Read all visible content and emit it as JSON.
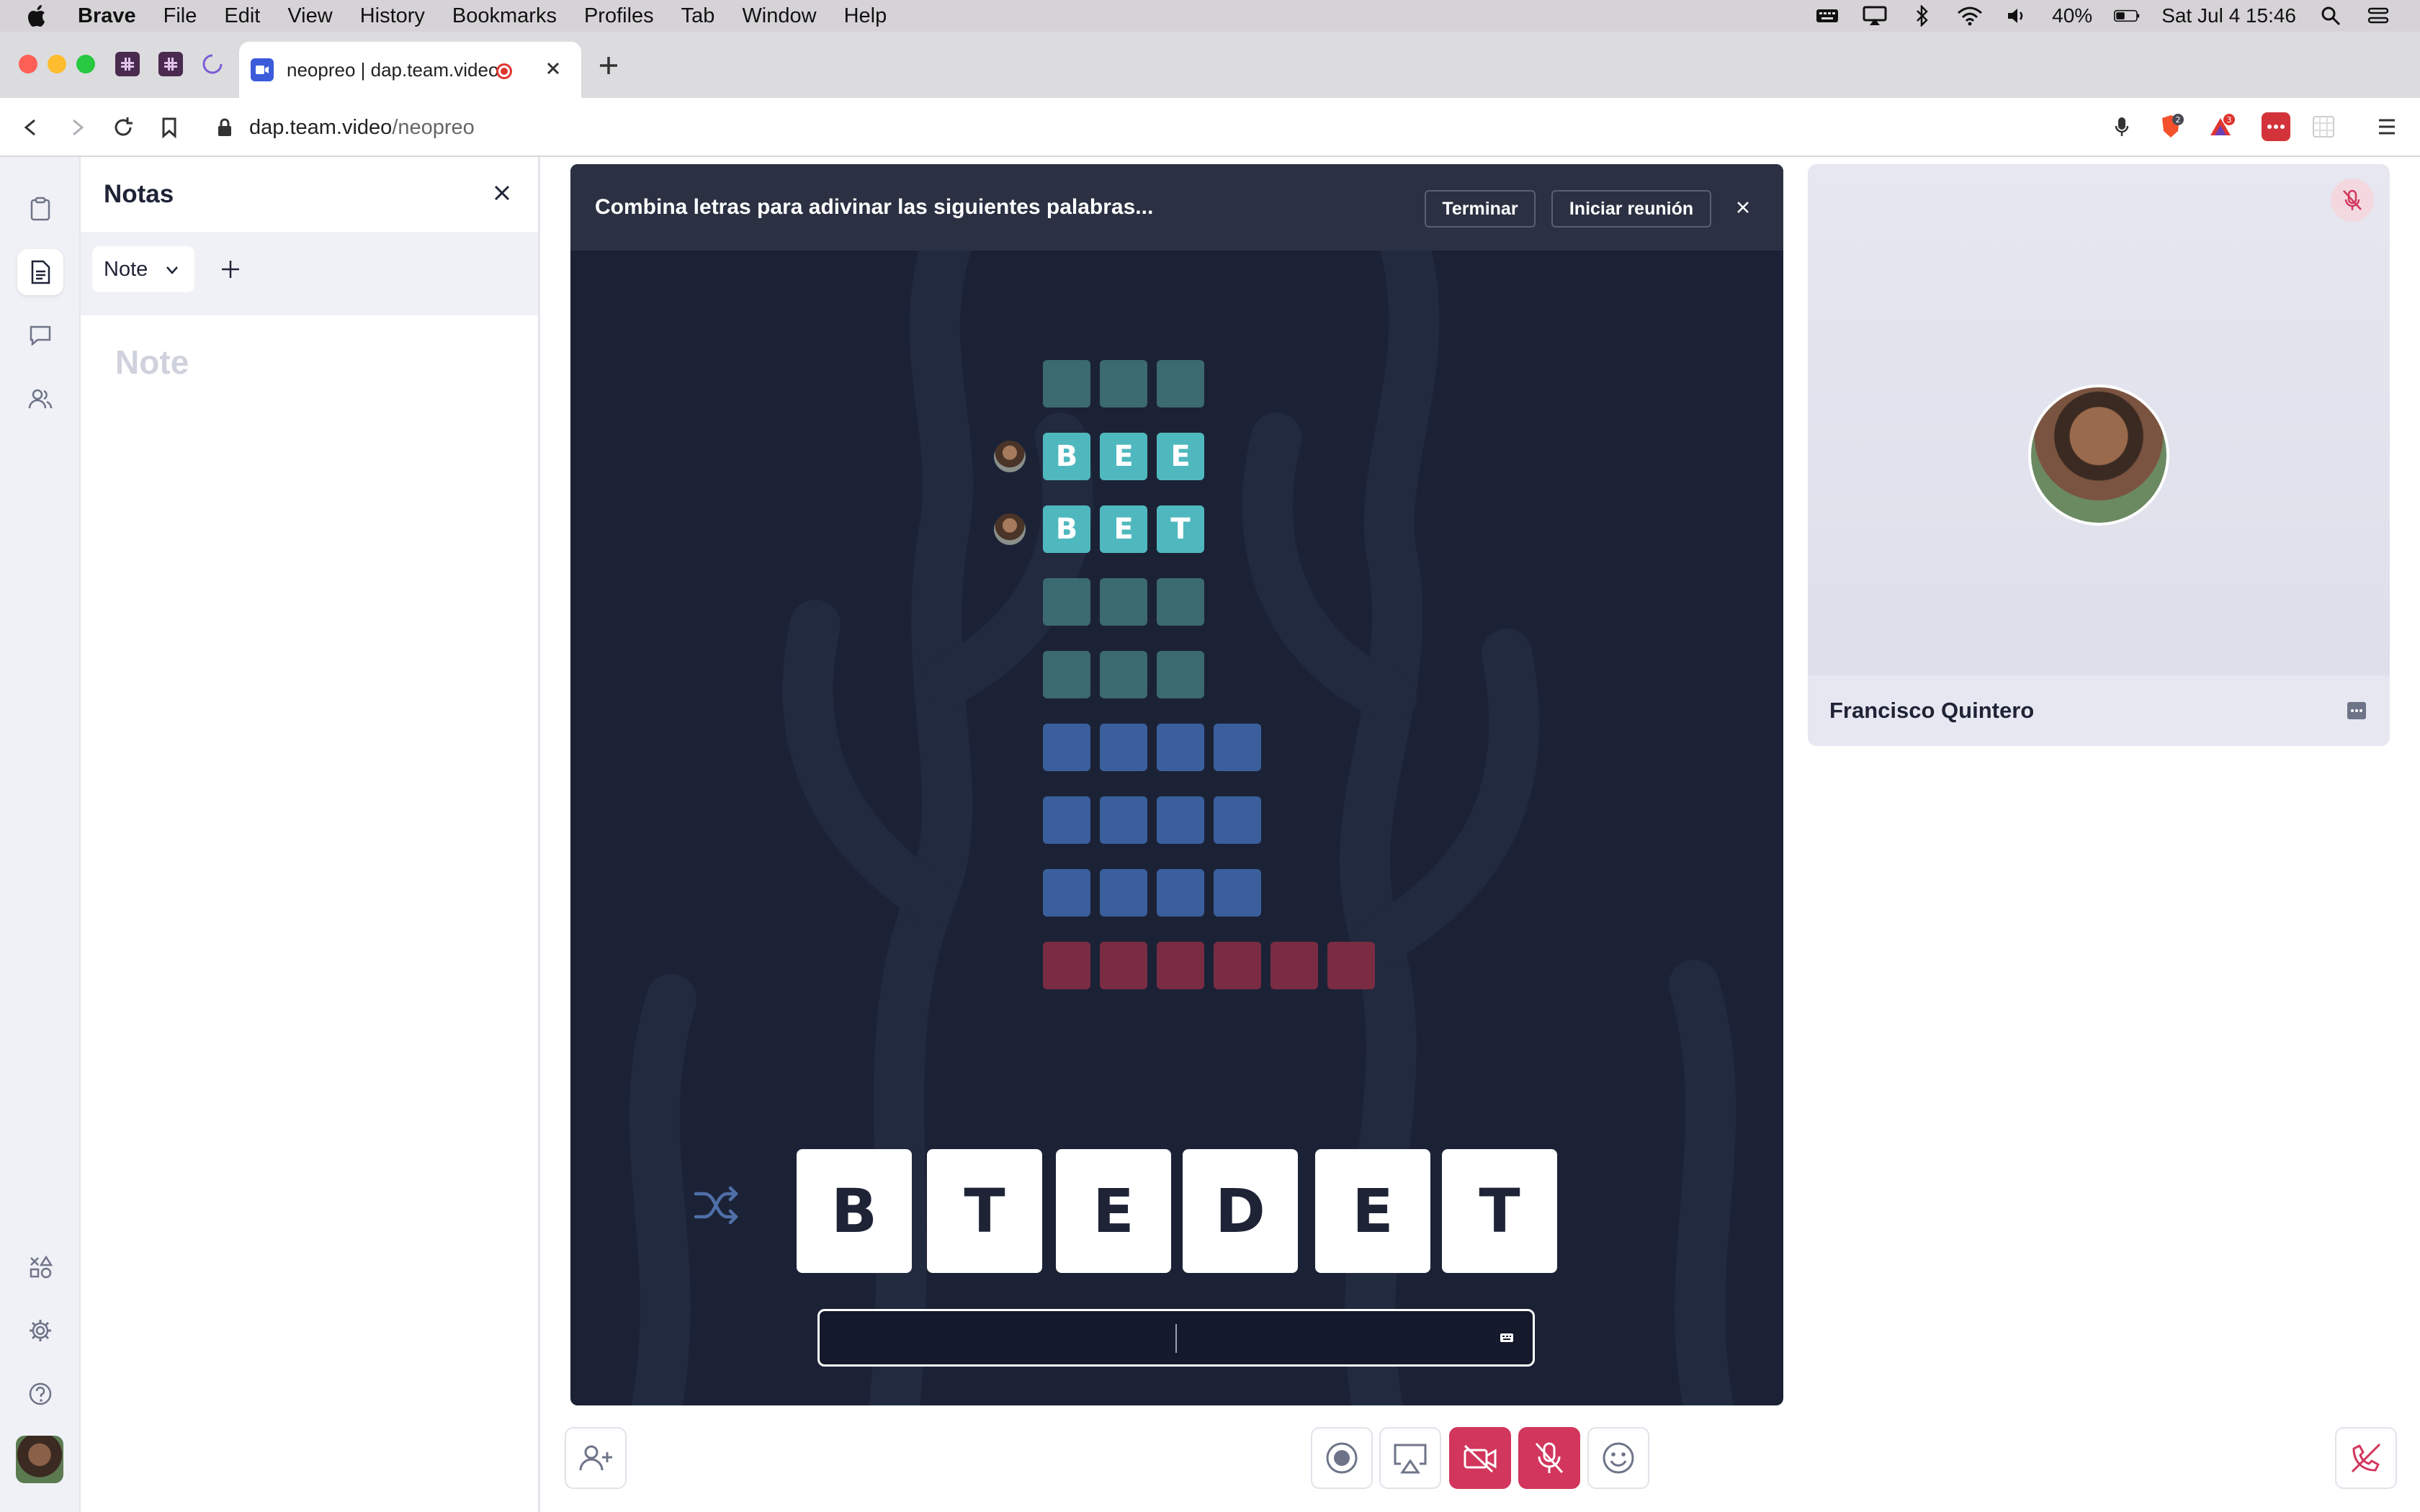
{
  "menubar": {
    "app": "Brave",
    "items": [
      "File",
      "Edit",
      "View",
      "History",
      "Bookmarks",
      "Profiles",
      "Tab",
      "Window",
      "Help"
    ],
    "battery": "40%",
    "clock": "Sat Jul 4  15:46"
  },
  "browser": {
    "tab_title": "neopreo | dap.team.video",
    "url_host": "dap.team.video",
    "url_path": "/neopreo",
    "brave_badge": "2",
    "alert_badge": "3"
  },
  "notes": {
    "title": "Notas",
    "selected_note": "Note",
    "placeholder": "Note"
  },
  "game": {
    "prompt": "Combina letras para adivinar las siguientes palabras...",
    "end_label": "Terminar",
    "start_meeting_label": "Iniciar reunión",
    "rows": [
      {
        "length": 3,
        "letters": [
          "",
          "",
          ""
        ],
        "state": "empty",
        "color": "#3b6a70"
      },
      {
        "length": 3,
        "letters": [
          "B",
          "E",
          "E"
        ],
        "state": "found",
        "color": "#4fb8be",
        "found_by_avatar": true
      },
      {
        "length": 3,
        "letters": [
          "B",
          "E",
          "T"
        ],
        "state": "found",
        "color": "#4fb8be",
        "found_by_avatar": true
      },
      {
        "length": 3,
        "letters": [
          "",
          "",
          ""
        ],
        "state": "empty",
        "color": "#3b6a70"
      },
      {
        "length": 3,
        "letters": [
          "",
          "",
          ""
        ],
        "state": "empty",
        "color": "#3b6a70"
      },
      {
        "length": 4,
        "letters": [
          "",
          "",
          "",
          ""
        ],
        "state": "empty",
        "color": "#3a5f9c"
      },
      {
        "length": 4,
        "letters": [
          "",
          "",
          "",
          ""
        ],
        "state": "empty",
        "color": "#3a5f9c"
      },
      {
        "length": 4,
        "letters": [
          "",
          "",
          "",
          ""
        ],
        "state": "empty",
        "color": "#3a5f9c"
      },
      {
        "length": 6,
        "letters": [
          "",
          "",
          "",
          "",
          "",
          ""
        ],
        "state": "empty",
        "color": "#7a2c42"
      }
    ],
    "available_letters": [
      "B",
      "T",
      "E",
      "D",
      "E",
      "T"
    ],
    "guess_value": ""
  },
  "participant": {
    "name": "Francisco Quintero",
    "muted": true
  },
  "toolbar": {
    "icons": [
      "invite-user-icon",
      "record-icon",
      "screen-share-icon",
      "camera-off-icon",
      "mic-off-icon",
      "emoji-icon",
      "leave-call-icon"
    ]
  },
  "colors": {
    "game_bg": "#1b2236",
    "game_header": "#2b3142",
    "danger": "#d2365d",
    "rail_bg": "#f0f1f6"
  }
}
